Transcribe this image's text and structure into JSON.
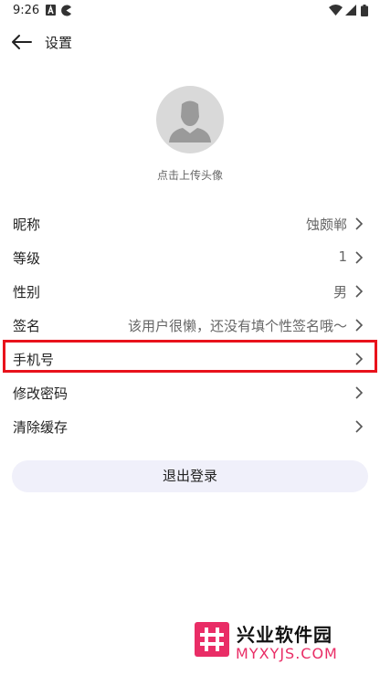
{
  "status_bar": {
    "time": "9:26",
    "icons": [
      "a-icon",
      "pacman-icon",
      "wifi-icon",
      "signal-icon",
      "battery-icon"
    ]
  },
  "header": {
    "back_icon": "arrow-left-icon",
    "title": "设置"
  },
  "avatar": {
    "icon": "person-silhouette-icon",
    "caption": "点击上传头像"
  },
  "settings": {
    "nickname": {
      "label": "昵称",
      "value": "蚀颇郸"
    },
    "level": {
      "label": "等级",
      "value": "1"
    },
    "gender": {
      "label": "性别",
      "value": "男"
    },
    "signature": {
      "label": "签名",
      "value": "该用户很懒，还没有填个性签名哦～"
    },
    "phone": {
      "label": "手机号",
      "value": ""
    },
    "change_password": {
      "label": "修改密码"
    },
    "clear_cache": {
      "label": "清除缓存"
    }
  },
  "logout": {
    "label": "退出登录"
  },
  "highlight_color": "#e8121b",
  "watermark": {
    "name": "兴业软件园",
    "domain": "MYXYJS.COM",
    "logo_color": "#e92d66"
  }
}
